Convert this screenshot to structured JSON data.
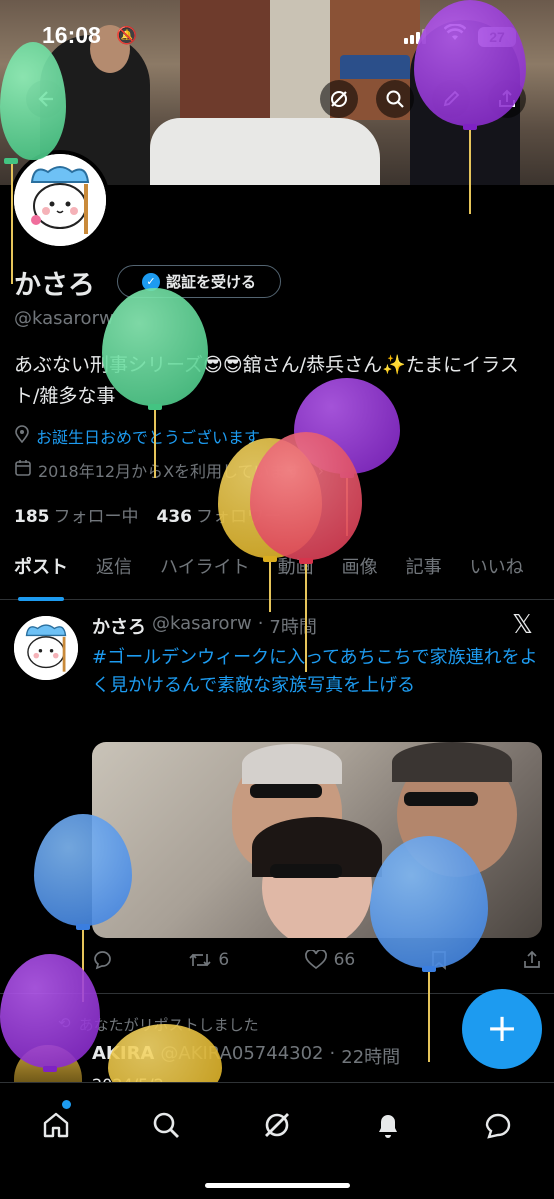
{
  "status_bar": {
    "time": "16:08",
    "battery": "27"
  },
  "profile": {
    "name": "かさろ",
    "verify_button": "認証を受ける",
    "handle": "@kasarorw",
    "bio": "あぶない刑事シリーズ😎😎舘さん/恭兵さん✨たまにイラスト/雑多な事",
    "birthday": "お誕生日おめでとうございます",
    "joined": "2018年12月からXを利用しています",
    "following_count": "185",
    "following_label": "フォロー中",
    "followers_count": "436",
    "followers_label": "フォロワー"
  },
  "tabs": [
    "ポスト",
    "返信",
    "ハイライト",
    "動画",
    "画像",
    "記事",
    "いいね"
  ],
  "post": {
    "author": "かさろ",
    "handle": "@kasarorw",
    "time": "7時間",
    "text": "#ゴールデンウィークに入ってあちこちで家族連れをよく見かけるんで素敵な家族写真を上げる",
    "reposts": "6",
    "likes": "66"
  },
  "post2": {
    "repost_note": "あなたがリポストしました",
    "author": "AKIRA",
    "handle": "@AKIRA05744302",
    "time": "22時間",
    "text": "2024/5/2"
  },
  "fab_label": "+",
  "icons": {
    "back": "back-arrow-icon",
    "grok": "grok-icon",
    "search": "search-icon",
    "edit": "edit-icon",
    "share": "share-icon",
    "home": "home-icon",
    "notifications": "bell-icon",
    "messages": "messages-icon"
  },
  "colors": {
    "accent": "#1d9bf0",
    "background": "#000000",
    "muted": "#71767b"
  }
}
